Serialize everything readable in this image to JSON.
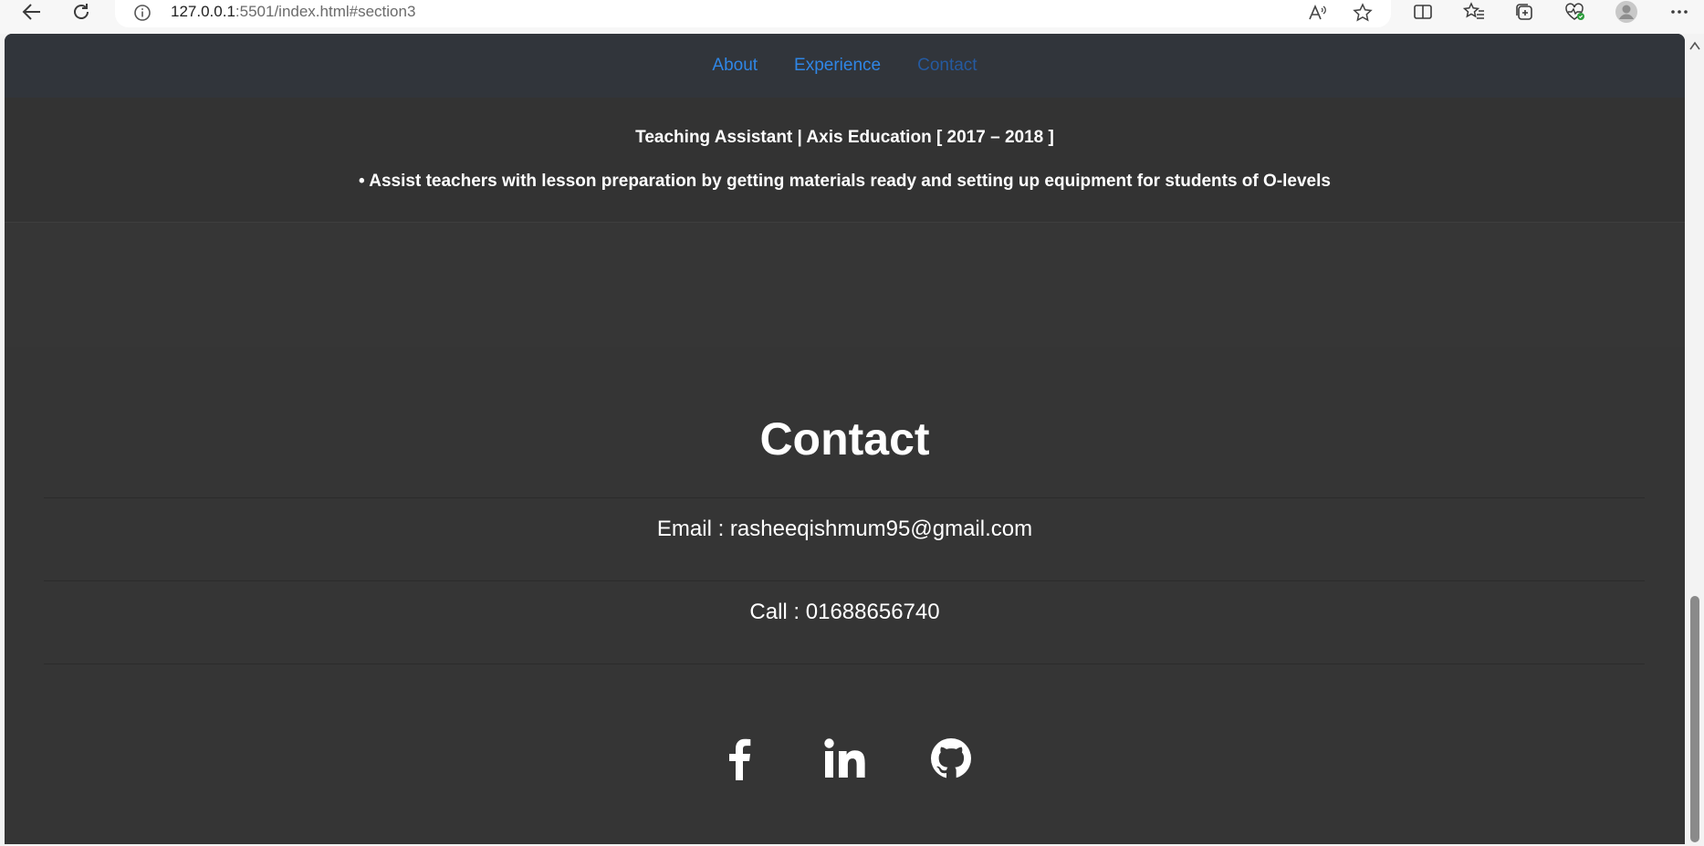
{
  "browser": {
    "url_host": "127.0.0.1",
    "url_rest": ":5501/index.html#section3",
    "icons": [
      "back-icon",
      "refresh-icon",
      "info-icon",
      "read-aloud-icon",
      "favorite-star-icon",
      "split-screen-icon",
      "favorites-icon",
      "collections-icon",
      "browser-essentials-icon",
      "profile-avatar-icon",
      "more-options-icon"
    ]
  },
  "nav": {
    "items": [
      {
        "label": "About"
      },
      {
        "label": "Experience"
      },
      {
        "label": "Contact"
      }
    ],
    "link_color": "#2f86e6"
  },
  "experience": {
    "title": "Teaching Assistant | Axis Education [ 2017 – 2018 ]",
    "bullet": "• Assist teachers with lesson preparation by getting materials ready and setting up equipment for students of O-levels"
  },
  "contact": {
    "heading": "Contact",
    "email_line": "Email : rasheeqishmum95@gmail.com",
    "call_line": "Call : 01688656740",
    "socials": [
      "facebook-icon",
      "linkedin-icon",
      "github-icon"
    ]
  },
  "colors": {
    "page_bg": "#363636",
    "nav_bg": "#31353b",
    "text": "#ffffff"
  }
}
